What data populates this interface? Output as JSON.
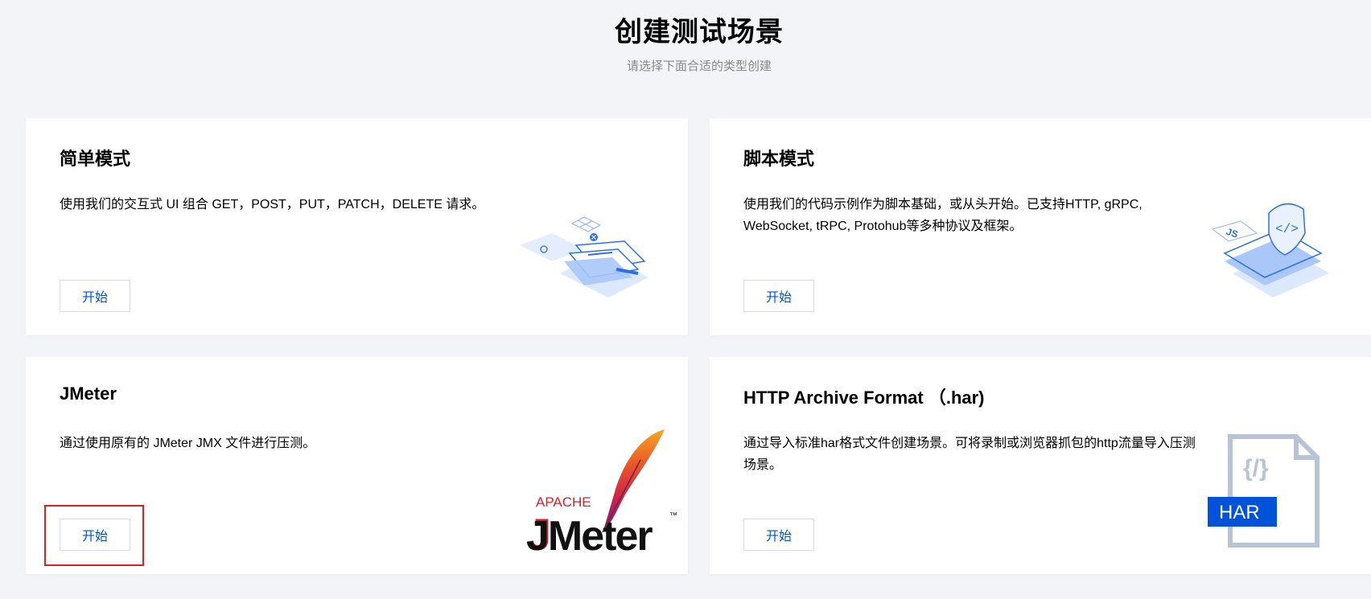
{
  "header": {
    "title": "创建测试场景",
    "subtitle": "请选择下面合适的类型创建"
  },
  "cards": [
    {
      "title": "简单模式",
      "description": "使用我们的交互式 UI 组合 GET，POST，PUT，PATCH，DELETE 请求。",
      "button_label": "开始",
      "illustration": "ui-builder-illustration"
    },
    {
      "title": "脚本模式",
      "description_line1": "使用我们的代码示例作为脚本基础，或从头开始。已支持HTTP, gRPC,",
      "description_line2": "WebSocket, tRPC, Protohub等多种协议及框架。",
      "button_label": "开始",
      "illustration": "script-js-illustration",
      "illustration_text": "JS",
      "illustration_code": "</>"
    },
    {
      "title": "JMeter",
      "description": "通过使用原有的 JMeter JMX 文件进行压测。",
      "button_label": "开始",
      "illustration": "apache-jmeter-logo",
      "logo_top": "APACHE",
      "logo_main": "JMeter",
      "logo_tm": "™"
    },
    {
      "title": "HTTP Archive Format （.har)",
      "description_line1": "通过导入标准har格式文件创建场景。可将录制或浏览器抓包的http流量导入压测",
      "description_line2": "场景。",
      "button_label": "开始",
      "illustration": "har-file-icon",
      "icon_code": "{/}",
      "icon_badge": "HAR"
    }
  ],
  "colors": {
    "background": "#f3f4f7",
    "accent": "#0052d9",
    "highlight": "#e02020",
    "illustration_blue": "#4d8cf5",
    "har_gray": "#b9c3d3"
  }
}
